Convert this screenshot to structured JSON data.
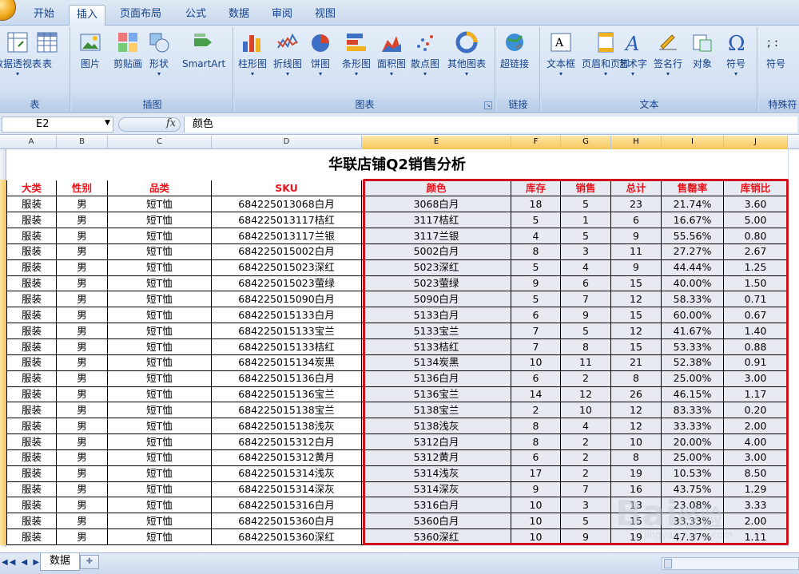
{
  "tabs": [
    {
      "label": "开始",
      "active": false
    },
    {
      "label": "插入",
      "active": true
    },
    {
      "label": "页面布局",
      "active": false
    },
    {
      "label": "公式",
      "active": false
    },
    {
      "label": "数据",
      "active": false
    },
    {
      "label": "审阅",
      "active": false
    },
    {
      "label": "视图",
      "active": false
    }
  ],
  "ribbon": {
    "groups": [
      {
        "label": "表",
        "buttons": [
          {
            "label": "数据透视表",
            "icon": "pivot-table-icon"
          },
          {
            "label": "表",
            "icon": "table-icon"
          }
        ]
      },
      {
        "label": "插图",
        "buttons": [
          {
            "label": "图片",
            "icon": "picture-icon"
          },
          {
            "label": "剪贴画",
            "icon": "clipart-icon"
          },
          {
            "label": "形状",
            "icon": "shapes-icon"
          },
          {
            "label": "SmartArt",
            "icon": "smartart-icon"
          }
        ]
      },
      {
        "label": "图表",
        "buttons": [
          {
            "label": "柱形图",
            "icon": "column-chart-icon"
          },
          {
            "label": "折线图",
            "icon": "line-chart-icon"
          },
          {
            "label": "饼图",
            "icon": "pie-chart-icon"
          },
          {
            "label": "条形图",
            "icon": "bar-chart-icon"
          },
          {
            "label": "面积图",
            "icon": "area-chart-icon"
          },
          {
            "label": "散点图",
            "icon": "scatter-chart-icon"
          },
          {
            "label": "其他图表",
            "icon": "other-charts-icon"
          }
        ]
      },
      {
        "label": "链接",
        "buttons": [
          {
            "label": "超链接",
            "icon": "hyperlink-icon"
          }
        ]
      },
      {
        "label": "文本",
        "buttons": [
          {
            "label": "文本框",
            "icon": "textbox-icon"
          },
          {
            "label": "页眉和页脚",
            "icon": "header-footer-icon"
          },
          {
            "label": "艺术字",
            "icon": "wordart-icon"
          },
          {
            "label": "签名行",
            "icon": "signature-icon"
          },
          {
            "label": "对象",
            "icon": "object-icon"
          },
          {
            "label": "符号",
            "icon": "omega-icon"
          }
        ]
      },
      {
        "label": "特殊符",
        "buttons": [
          {
            "label": "符号",
            "icon": "special-symbol-icon"
          }
        ]
      }
    ]
  },
  "formula_bar": {
    "cell_ref": "E2",
    "fx": "fx",
    "content": "颜色"
  },
  "columns": [
    "A",
    "B",
    "C",
    "D",
    "E",
    "F",
    "G",
    "H",
    "I",
    "J"
  ],
  "sheet": {
    "title": "华联店铺Q2销售分析",
    "headers": [
      "大类",
      "性别",
      "品类",
      "SKU",
      "颜色",
      "库存",
      "销售",
      "总计",
      "售罄率",
      "库销比"
    ],
    "rows": [
      [
        "服装",
        "男",
        "短T恤",
        "684225013068白月",
        "3068白月",
        "18",
        "5",
        "23",
        "21.74%",
        "3.60"
      ],
      [
        "服装",
        "男",
        "短T恤",
        "684225013117桔红",
        "3117桔红",
        "5",
        "1",
        "6",
        "16.67%",
        "5.00"
      ],
      [
        "服装",
        "男",
        "短T恤",
        "684225013117兰银",
        "3117兰银",
        "4",
        "5",
        "9",
        "55.56%",
        "0.80"
      ],
      [
        "服装",
        "男",
        "短T恤",
        "684225015002白月",
        "5002白月",
        "8",
        "3",
        "11",
        "27.27%",
        "2.67"
      ],
      [
        "服装",
        "男",
        "短T恤",
        "684225015023深红",
        "5023深红",
        "5",
        "4",
        "9",
        "44.44%",
        "1.25"
      ],
      [
        "服装",
        "男",
        "短T恤",
        "684225015023萤绿",
        "5023萤绿",
        "9",
        "6",
        "15",
        "40.00%",
        "1.50"
      ],
      [
        "服装",
        "男",
        "短T恤",
        "684225015090白月",
        "5090白月",
        "5",
        "7",
        "12",
        "58.33%",
        "0.71"
      ],
      [
        "服装",
        "男",
        "短T恤",
        "684225015133白月",
        "5133白月",
        "6",
        "9",
        "15",
        "60.00%",
        "0.67"
      ],
      [
        "服装",
        "男",
        "短T恤",
        "684225015133宝兰",
        "5133宝兰",
        "7",
        "5",
        "12",
        "41.67%",
        "1.40"
      ],
      [
        "服装",
        "男",
        "短T恤",
        "684225015133桔红",
        "5133桔红",
        "7",
        "8",
        "15",
        "53.33%",
        "0.88"
      ],
      [
        "服装",
        "男",
        "短T恤",
        "684225015134炭黑",
        "5134炭黑",
        "10",
        "11",
        "21",
        "52.38%",
        "0.91"
      ],
      [
        "服装",
        "男",
        "短T恤",
        "684225015136白月",
        "5136白月",
        "6",
        "2",
        "8",
        "25.00%",
        "3.00"
      ],
      [
        "服装",
        "男",
        "短T恤",
        "684225015136宝兰",
        "5136宝兰",
        "14",
        "12",
        "26",
        "46.15%",
        "1.17"
      ],
      [
        "服装",
        "男",
        "短T恤",
        "684225015138宝兰",
        "5138宝兰",
        "2",
        "10",
        "12",
        "83.33%",
        "0.20"
      ],
      [
        "服装",
        "男",
        "短T恤",
        "684225015138浅灰",
        "5138浅灰",
        "8",
        "4",
        "12",
        "33.33%",
        "2.00"
      ],
      [
        "服装",
        "男",
        "短T恤",
        "684225015312白月",
        "5312白月",
        "8",
        "2",
        "10",
        "20.00%",
        "4.00"
      ],
      [
        "服装",
        "男",
        "短T恤",
        "684225015312黄月",
        "5312黄月",
        "6",
        "2",
        "8",
        "25.00%",
        "3.00"
      ],
      [
        "服装",
        "男",
        "短T恤",
        "684225015314浅灰",
        "5314浅灰",
        "17",
        "2",
        "19",
        "10.53%",
        "8.50"
      ],
      [
        "服装",
        "男",
        "短T恤",
        "684225015314深灰",
        "5314深灰",
        "9",
        "7",
        "16",
        "43.75%",
        "1.29"
      ],
      [
        "服装",
        "男",
        "短T恤",
        "684225015316白月",
        "5316白月",
        "10",
        "3",
        "13",
        "23.08%",
        "3.33"
      ],
      [
        "服装",
        "男",
        "短T恤",
        "684225015360白月",
        "5360白月",
        "10",
        "5",
        "15",
        "33.33%",
        "2.00"
      ],
      [
        "服装",
        "男",
        "短T恤",
        "684225015360深红",
        "5360深红",
        "10",
        "9",
        "19",
        "47.37%",
        "1.11"
      ]
    ]
  },
  "sheet_tabs": [
    {
      "label": "数据"
    }
  ],
  "watermark": {
    "text": "Bai",
    "text2": "经验",
    "url": "jingyan.baidu.com"
  },
  "colors": {
    "header_red": "#e8141b",
    "selection_border": "#d0121c",
    "ribbon_text": "#15428b"
  }
}
